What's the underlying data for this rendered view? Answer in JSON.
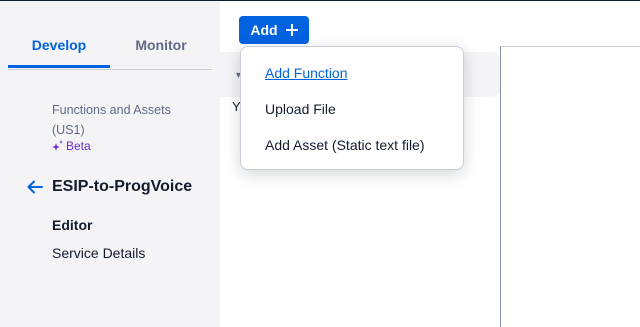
{
  "colors": {
    "accent": "#0263e0",
    "sidebar_bg": "#f4f4f6",
    "beta": "#6d2ed1",
    "text_primary": "#121c2d",
    "text_muted": "#606b85"
  },
  "sidebar": {
    "tabs": [
      {
        "label": "Develop",
        "active": true
      },
      {
        "label": "Monitor",
        "active": false
      }
    ],
    "section_title": "Functions and Assets (US1)",
    "beta_label": "Beta",
    "service_name": "ESIP-to-ProgVoice",
    "nav": [
      {
        "label": "Editor",
        "active": true
      },
      {
        "label": "Service Details",
        "active": false
      }
    ]
  },
  "toolbar": {
    "add_label": "Add"
  },
  "add_menu": {
    "items": [
      {
        "label": "Add Function",
        "highlighted": true
      },
      {
        "label": "Upload File"
      },
      {
        "label": "Add Asset (Static text file)"
      }
    ]
  },
  "main": {
    "partial_text": "Y"
  }
}
